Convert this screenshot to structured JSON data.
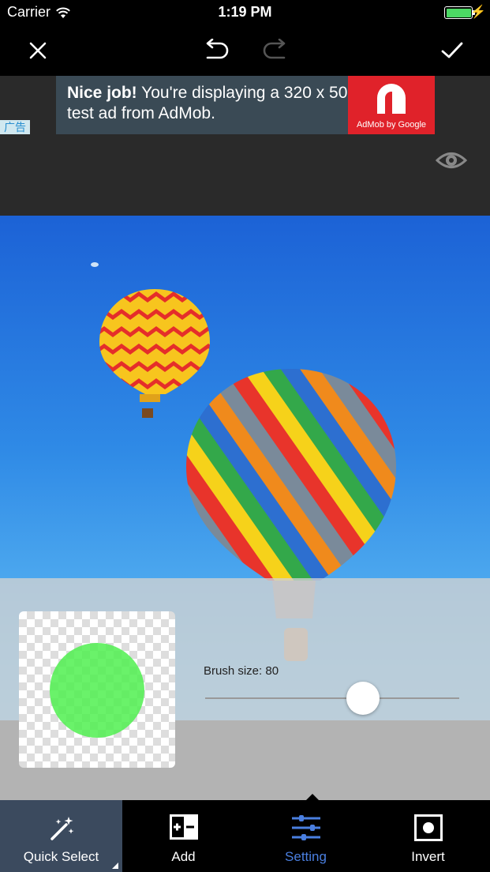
{
  "status": {
    "carrier": "Carrier",
    "time": "1:19 PM"
  },
  "topbar": {
    "close_icon": "close-icon",
    "undo_icon": "undo-icon",
    "redo_icon": "redo-icon",
    "confirm_icon": "check-icon"
  },
  "ad": {
    "headline": "Nice job!",
    "body": " You're displaying a 320 x 50 test ad from AdMob.",
    "brand": "AdMob by Google",
    "tag": "广告",
    "accent": "#e0222a"
  },
  "editor": {
    "brush_label": "Brush size: 80",
    "brush_level": 0.62,
    "preview_color": "#50f050"
  },
  "tabs": [
    {
      "label": "Quick Select",
      "icon": "magic-wand-icon"
    },
    {
      "label": "Add",
      "icon": "add-remove-icon"
    },
    {
      "label": "Setting",
      "icon": "sliders-icon"
    },
    {
      "label": "Invert",
      "icon": "invert-icon"
    }
  ],
  "colors": {
    "selected_tab": "#4a7fe0",
    "active_tab_bg": "#3b4a5e"
  }
}
